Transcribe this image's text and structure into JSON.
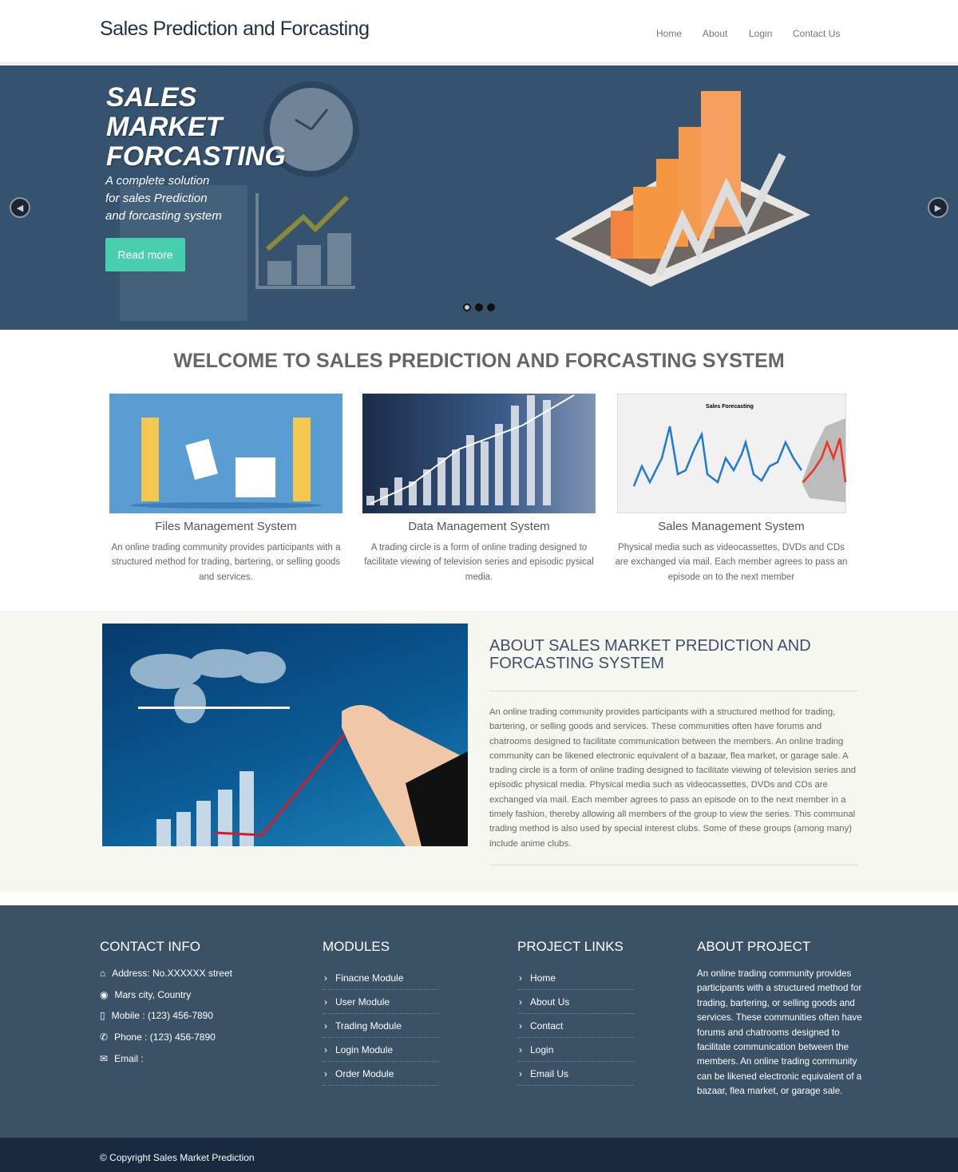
{
  "header": {
    "brand": "Sales Prediction and Forcasting",
    "nav": [
      "Home",
      "About",
      "Login",
      "Contact Us"
    ]
  },
  "hero": {
    "title_lines": [
      "SALES",
      "MARKET",
      "FORCASTING"
    ],
    "subtitle_lines": [
      "A complete solution",
      "for sales Prediction",
      "and forcasting system"
    ],
    "button": "Read more",
    "slides": 3,
    "active_slide": 1
  },
  "welcome": {
    "title": "WELCOME TO SALES PREDICTION AND FORCASTING SYSTEM"
  },
  "cards": [
    {
      "title": "Files Management System",
      "text": "An online trading community provides participants with a structured method for trading, bartering, or selling goods and services.",
      "chart_label": ""
    },
    {
      "title": "Data Management System",
      "text": "A trading circle is a form of online trading designed to facilitate viewing of television series and episodic pysical media.",
      "chart_label": ""
    },
    {
      "title": "Sales Management System",
      "text": "Physical media such as videocassettes, DVDs and CDs are exchanged via mail. Each member agrees to pass an episode on to the next member",
      "chart_label": "Sales Forecasting"
    }
  ],
  "about": {
    "title": "ABOUT SALES MARKET PREDICTION AND FORCASTING SYSTEM",
    "text": "An online trading community provides participants with a structured method for trading, bartering, or selling goods and services. These communities often have forums and chatrooms designed to facilitate communication between the members. An online trading community can be likened electronic equivalent of a bazaar, flea market, or garage sale. A trading circle is a form of online trading designed to facilitate viewing of television series and episodic physical media. Physical media such as videocassettes, DVDs and CDs are exchanged via mail. Each member agrees to pass an episode on to the next member in a timely fashion, thereby allowing all members of the group to view the series. This communal trading method is also used by special interest clubs. Some of these groups (among many) include anime clubs."
  },
  "footer": {
    "contact": {
      "title": "CONTACT INFO",
      "items": [
        {
          "icon": "home-icon",
          "text": "Address: No.XXXXXX street"
        },
        {
          "icon": "globe-icon",
          "text": "Mars city, Country"
        },
        {
          "icon": "mobile-icon",
          "text": "Mobile : (123) 456-7890"
        },
        {
          "icon": "phone-icon",
          "text": "Phone : (123) 456-7890"
        },
        {
          "icon": "envelope-icon",
          "text": "Email :"
        }
      ]
    },
    "modules": {
      "title": "MODULES",
      "items": [
        "Finacne Module",
        "User Module",
        "Trading Module",
        "Login Module",
        "Order Module"
      ]
    },
    "links": {
      "title": "PROJECT LINKS",
      "items": [
        "Home",
        "About Us",
        "Contact",
        "Login",
        "Email Us"
      ]
    },
    "about": {
      "title": "ABOUT PROJECT",
      "text": "An online trading community provides participants with a structured method for trading, bartering, or selling goods and services. These communities often have forums and chatrooms designed to facilitate communication between the members. An online trading community can be likened electronic equivalent of a bazaar, flea market, or garage sale."
    },
    "copyright": "© Copyright Sales Market Prediction"
  },
  "colors": {
    "hero_bg": "#35536f",
    "accent": "#48cfae",
    "footer_bg": "#3b5166",
    "bottom_bg": "#172a40"
  }
}
